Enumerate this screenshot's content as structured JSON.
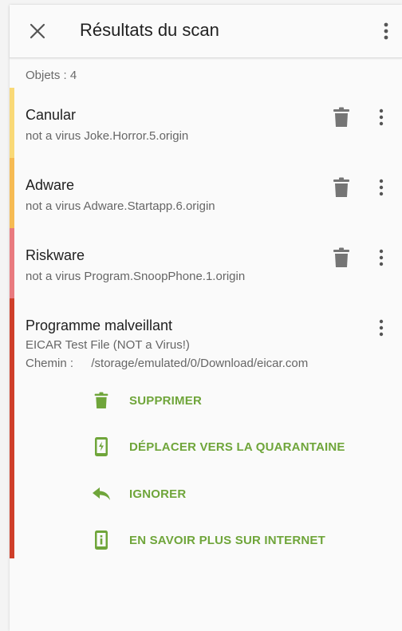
{
  "header": {
    "title": "Résultats du scan"
  },
  "summary": {
    "count_label": "Objets : 4"
  },
  "items": [
    {
      "title": "Canular",
      "detail": "not a virus Joke.Horror.5.origin",
      "color": "#f9d977"
    },
    {
      "title": "Adware",
      "detail": "not a virus Adware.Startapp.6.origin",
      "color": "#f6bb53"
    },
    {
      "title": "Riskware",
      "detail": "not a virus Program.SnoopPhone.1.origin",
      "color": "#e97a7f"
    },
    {
      "title": "Programme malveillant",
      "detail": "EICAR Test File (NOT a Virus!)",
      "path_label": "Chemin :",
      "path_value": "/storage/emulated/0/Download/eicar.com",
      "color": "#cf3f2a"
    }
  ],
  "actions": {
    "delete": "SUPPRIMER",
    "quarantine": "DÉPLACER VERS LA QUARANTAINE",
    "ignore": "IGNORER",
    "learn_more": "EN SAVOIR PLUS SUR INTERNET"
  },
  "icons": {
    "close": "close-icon",
    "menu": "more-vert-icon",
    "trash": "trash-icon",
    "quarantine": "phone-bolt-icon",
    "ignore": "reply-icon",
    "info": "info-icon"
  },
  "colors": {
    "accent": "#6fa53a",
    "icon_gray": "#757575"
  }
}
